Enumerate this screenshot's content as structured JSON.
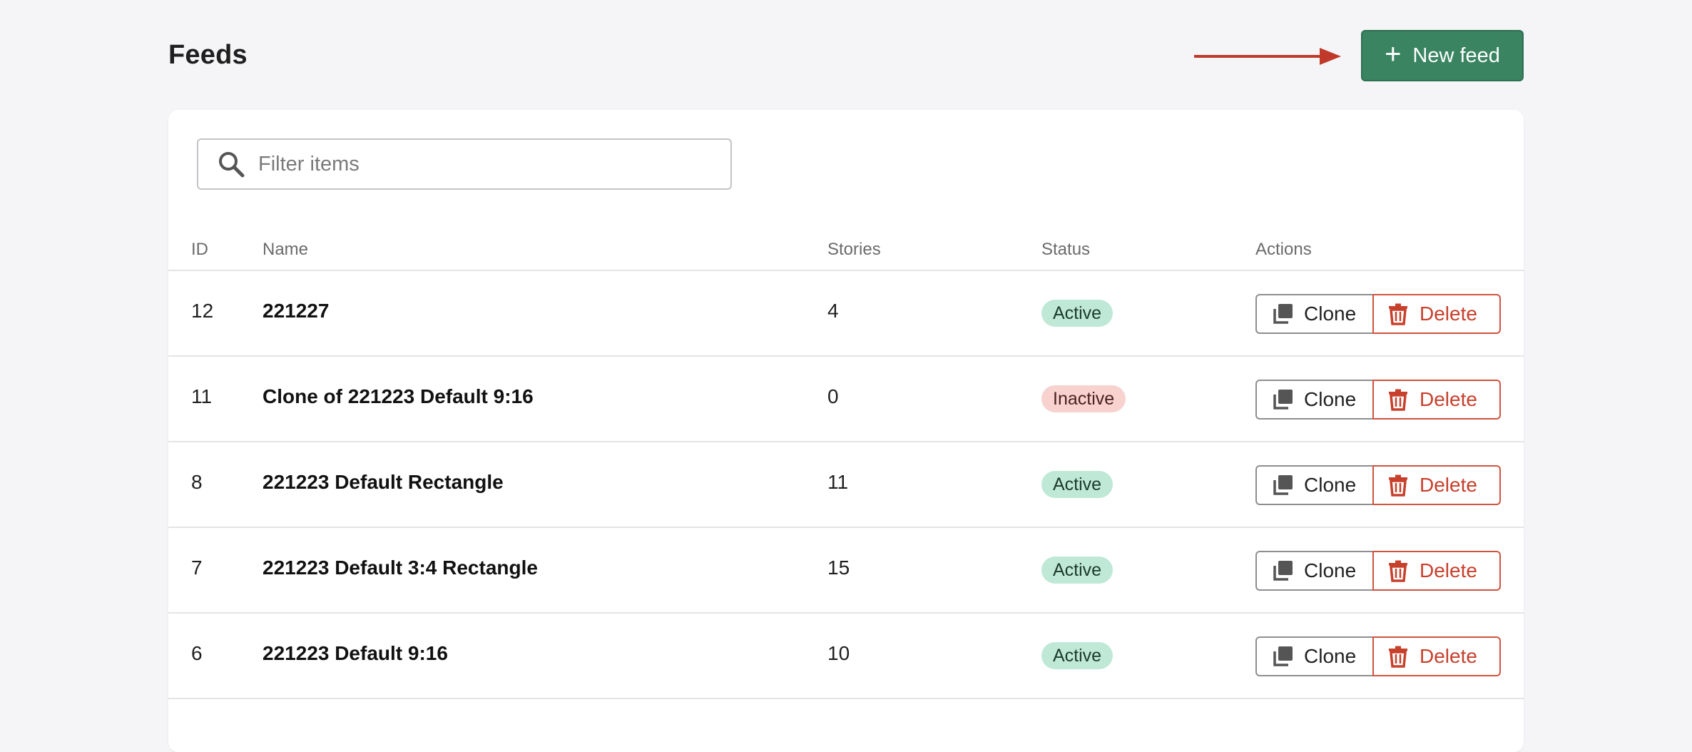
{
  "header": {
    "title": "Feeds",
    "new_button_label": "New feed"
  },
  "search": {
    "placeholder": "Filter items"
  },
  "table": {
    "columns": [
      "ID",
      "Name",
      "Stories",
      "Status",
      "Actions"
    ],
    "rows": [
      {
        "id": "12",
        "name": "221227",
        "stories": "4",
        "status": "Active"
      },
      {
        "id": "11",
        "name": "Clone of 221223 Default 9:16",
        "stories": "0",
        "status": "Inactive"
      },
      {
        "id": "8",
        "name": "221223 Default Rectangle",
        "stories": "11",
        "status": "Active"
      },
      {
        "id": "7",
        "name": "221223 Default 3:4 Rectangle",
        "stories": "15",
        "status": "Active"
      },
      {
        "id": "6",
        "name": "221223 Default 9:16",
        "stories": "10",
        "status": "Active"
      }
    ],
    "clone_label": "Clone",
    "delete_label": "Delete"
  },
  "colors": {
    "primary": "#3a8461",
    "danger": "#c7402c",
    "annotation_arrow": "#c0392b",
    "active_badge": "#bfe9d6",
    "inactive_badge": "#f7d2cf"
  },
  "icons": [
    "plus-icon",
    "search-icon",
    "clone-icon",
    "trash-icon",
    "arrow-annotation"
  ]
}
